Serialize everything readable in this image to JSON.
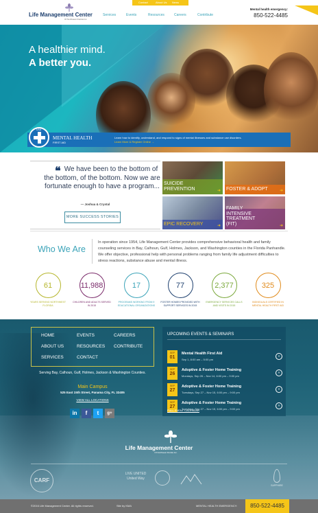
{
  "utility": {
    "links": [
      "Contact",
      "About Us",
      "News"
    ]
  },
  "header": {
    "logo_name": "Life Management Center",
    "logo_sub": "Of Northwest Florida Inc.",
    "nav": [
      "Services",
      "Events",
      "Resources",
      "Careers",
      "Contribute"
    ],
    "emergency_label": "Mental health emergency:",
    "emergency_phone": "850-522-4485"
  },
  "hero": {
    "line1": "A healthier mind.",
    "line2": "A better you.",
    "mhfa_usa": "USA",
    "mhfa_title": "MENTAL HEALTH",
    "mhfa_sub": "FIRST AID",
    "mhfa_desc": "Learn how to identify, understand, and respond to signs of mental illnesses and substance use disorders.",
    "mhfa_link": "Learn More & Register Online →"
  },
  "testimonial": {
    "quote": "We have been to the bottom of the bottom, of the bottom. Now we are fortunate enough to have a program...",
    "author": "— Joshua & Crystal",
    "button": "MORE SUCCESS STORIES"
  },
  "tiles": [
    {
      "label": "SUICIDE PREVENTION"
    },
    {
      "label": "FOSTER & ADOPT"
    },
    {
      "label": "EPIC RECOVERY"
    },
    {
      "label": "FAMILY INTENSIVE TREATMENT (FIT)"
    }
  ],
  "who": {
    "title": "Who We Are",
    "text": "In operation since 1954, Life Management Center provides comprehensive behavioral health and family counseling services in Bay, Calhoun, Gulf, Holmes, Jackson, and Washington counties in the Florida Panhandle. We offer objective, professional help with personal problems ranging from family life adjustment difficulties to stress reactions, substance abuse and mental illness."
  },
  "stats": [
    {
      "value": "61",
      "caption": "YEARS SERVING NORTHWEST FLORIDA",
      "color": "#b5b52a"
    },
    {
      "value": "11,988",
      "caption": "CHILDREN AND ADULTS SERVED IN 2015",
      "color": "#7a2a6a"
    },
    {
      "value": "17",
      "caption": "PROGRAMS WORKING FROM 9 EDUCATIONAL ORGANIZATIONS",
      "color": "#3aa3b8"
    },
    {
      "value": "77",
      "caption": "FOSTER HOMES PROVIDED WITH SUPPORT SERVICES IN 2015",
      "color": "#1d3f6e"
    },
    {
      "value": "2,377",
      "caption": "EMERGENCY SERVICES CALLS AND VISITS IN 2015",
      "color": "#7aa83a"
    },
    {
      "value": "325",
      "caption": "INDIVIDUALS CERTIFIED IN MENTAL HEALTH FIRST AID",
      "color": "#e08a1a"
    }
  ],
  "footer": {
    "nav": [
      "HOME",
      "EVENTS",
      "CAREERS",
      "ABOUT US",
      "RESOURCES",
      "CONTRIBUTE",
      "SERVICES",
      "CONTACT"
    ],
    "serving": "Serving Bay, Calhoun, Gulf, Holmes, Jackson & Washington Counties.",
    "campus": "Main Campus",
    "address": "525 East 15th Street, Panama City, FL 32405",
    "view_all": "VIEW ALL LOCATIONS",
    "social": [
      "in",
      "f",
      "t",
      "g+"
    ],
    "events_head": "UPCOMING EVENTS & SEMINARS",
    "events": [
      {
        "month": "SEP",
        "day": "01",
        "title": "Mental Health First Aid",
        "when": "Sep 1, 8:00 am – 5:00 pm"
      },
      {
        "month": "SEP",
        "day": "26",
        "title": "Adoptive & Foster Home Training",
        "when": "Mondays, Sep 26 – Nov 14, 6:00 pm – 9:00 pm"
      },
      {
        "month": "SEP",
        "day": "27",
        "title": "Adoptive & Foster Home Training",
        "when": "Tuesdays, Sep 27 – Nov 15, 6:00 pm – 9:00 pm"
      },
      {
        "month": "SEP",
        "day": "27",
        "title": "Adoptive & Foster Home Training",
        "when": "Tuesdays, Sep 27 – Nov 15, 6:00 pm – 9:00 pm"
      }
    ],
    "calendar": "FULL EVENT CALENDAR",
    "logo_name": "Life Management Center",
    "logo_sub": "Of Northwest Florida Inc.",
    "partners": [
      "CARF",
      "LIVE UNITED United Way",
      "SAPPHIRE"
    ],
    "copyright": "©2016 Life Management Center. All rights reserved.",
    "site_by": "Site by KMA",
    "emergency_label": "MENTAL HEALTH EMERGENCY:",
    "emergency_phone": "850-522-4485"
  }
}
